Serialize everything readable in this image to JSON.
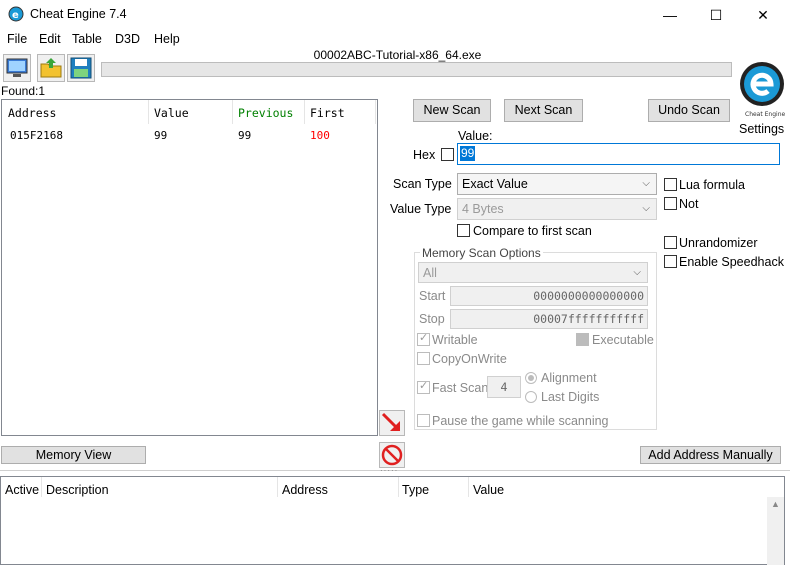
{
  "window": {
    "title": "Cheat Engine 7.4",
    "minimize": "—",
    "maximize": "☐",
    "close": "✕"
  },
  "menu": [
    "File",
    "Edit",
    "Table",
    "D3D",
    "Help"
  ],
  "process_name": "00002ABC-Tutorial-x86_64.exe",
  "found_label": "Found:1",
  "results": {
    "headers": [
      "Address",
      "Value",
      "Previous",
      "First"
    ],
    "rows": [
      {
        "address": "015F2168",
        "value": "99",
        "previous": "99",
        "first": "100"
      }
    ]
  },
  "buttons": {
    "new_scan": "New Scan",
    "next_scan": "Next Scan",
    "undo_scan": "Undo Scan",
    "settings": "Settings",
    "memory_view": "Memory View",
    "add_address": "Add Address Manually"
  },
  "value_label": "Value:",
  "hex_label": "Hex",
  "value_input": "99",
  "scan_type": {
    "label": "Scan Type",
    "selected": "Exact Value"
  },
  "value_type": {
    "label": "Value Type",
    "selected": "4 Bytes"
  },
  "compare_first": "Compare to first scan",
  "lua_formula": "Lua formula",
  "not_label": "Not",
  "unrandomizer": "Unrandomizer",
  "enable_speedhack": "Enable Speedhack",
  "memory_scan_options": {
    "title": "Memory Scan Options",
    "region": "All",
    "start_label": "Start",
    "start_value": "0000000000000000",
    "stop_label": "Stop",
    "stop_value": "00007fffffffffff",
    "writable": "Writable",
    "executable": "Executable",
    "copy_on_write": "CopyOnWrite",
    "fast_scan": "Fast Scan",
    "fast_scan_value": "4",
    "alignment": "Alignment",
    "last_digits": "Last Digits",
    "pause": "Pause the game while scanning"
  },
  "address_list": {
    "headers": [
      "Active",
      "Description",
      "Address",
      "Type",
      "Value"
    ]
  },
  "colors": {
    "previous_header": "#008000",
    "first_value": "#ff0000",
    "selection": "#0078d7",
    "logo": "#1b9ad6"
  }
}
